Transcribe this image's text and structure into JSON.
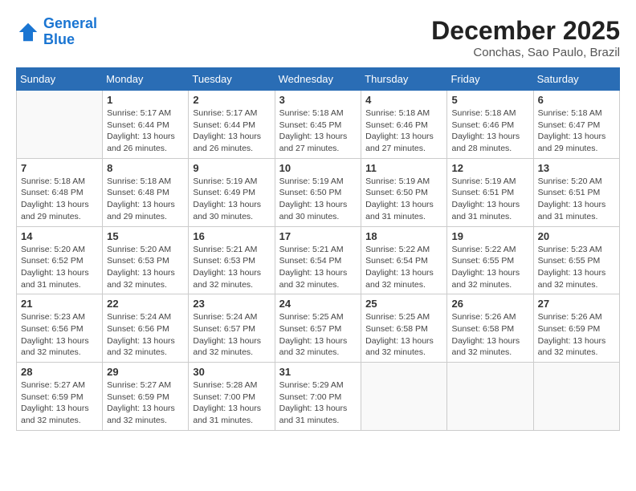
{
  "logo": {
    "line1": "General",
    "line2": "Blue"
  },
  "title": "December 2025",
  "location": "Conchas, Sao Paulo, Brazil",
  "days_of_week": [
    "Sunday",
    "Monday",
    "Tuesday",
    "Wednesday",
    "Thursday",
    "Friday",
    "Saturday"
  ],
  "weeks": [
    [
      {
        "day": "",
        "info": ""
      },
      {
        "day": "1",
        "info": "Sunrise: 5:17 AM\nSunset: 6:44 PM\nDaylight: 13 hours\nand 26 minutes."
      },
      {
        "day": "2",
        "info": "Sunrise: 5:17 AM\nSunset: 6:44 PM\nDaylight: 13 hours\nand 26 minutes."
      },
      {
        "day": "3",
        "info": "Sunrise: 5:18 AM\nSunset: 6:45 PM\nDaylight: 13 hours\nand 27 minutes."
      },
      {
        "day": "4",
        "info": "Sunrise: 5:18 AM\nSunset: 6:46 PM\nDaylight: 13 hours\nand 27 minutes."
      },
      {
        "day": "5",
        "info": "Sunrise: 5:18 AM\nSunset: 6:46 PM\nDaylight: 13 hours\nand 28 minutes."
      },
      {
        "day": "6",
        "info": "Sunrise: 5:18 AM\nSunset: 6:47 PM\nDaylight: 13 hours\nand 29 minutes."
      }
    ],
    [
      {
        "day": "7",
        "info": "Sunrise: 5:18 AM\nSunset: 6:48 PM\nDaylight: 13 hours\nand 29 minutes."
      },
      {
        "day": "8",
        "info": "Sunrise: 5:18 AM\nSunset: 6:48 PM\nDaylight: 13 hours\nand 29 minutes."
      },
      {
        "day": "9",
        "info": "Sunrise: 5:19 AM\nSunset: 6:49 PM\nDaylight: 13 hours\nand 30 minutes."
      },
      {
        "day": "10",
        "info": "Sunrise: 5:19 AM\nSunset: 6:50 PM\nDaylight: 13 hours\nand 30 minutes."
      },
      {
        "day": "11",
        "info": "Sunrise: 5:19 AM\nSunset: 6:50 PM\nDaylight: 13 hours\nand 31 minutes."
      },
      {
        "day": "12",
        "info": "Sunrise: 5:19 AM\nSunset: 6:51 PM\nDaylight: 13 hours\nand 31 minutes."
      },
      {
        "day": "13",
        "info": "Sunrise: 5:20 AM\nSunset: 6:51 PM\nDaylight: 13 hours\nand 31 minutes."
      }
    ],
    [
      {
        "day": "14",
        "info": "Sunrise: 5:20 AM\nSunset: 6:52 PM\nDaylight: 13 hours\nand 31 minutes."
      },
      {
        "day": "15",
        "info": "Sunrise: 5:20 AM\nSunset: 6:53 PM\nDaylight: 13 hours\nand 32 minutes."
      },
      {
        "day": "16",
        "info": "Sunrise: 5:21 AM\nSunset: 6:53 PM\nDaylight: 13 hours\nand 32 minutes."
      },
      {
        "day": "17",
        "info": "Sunrise: 5:21 AM\nSunset: 6:54 PM\nDaylight: 13 hours\nand 32 minutes."
      },
      {
        "day": "18",
        "info": "Sunrise: 5:22 AM\nSunset: 6:54 PM\nDaylight: 13 hours\nand 32 minutes."
      },
      {
        "day": "19",
        "info": "Sunrise: 5:22 AM\nSunset: 6:55 PM\nDaylight: 13 hours\nand 32 minutes."
      },
      {
        "day": "20",
        "info": "Sunrise: 5:23 AM\nSunset: 6:55 PM\nDaylight: 13 hours\nand 32 minutes."
      }
    ],
    [
      {
        "day": "21",
        "info": "Sunrise: 5:23 AM\nSunset: 6:56 PM\nDaylight: 13 hours\nand 32 minutes."
      },
      {
        "day": "22",
        "info": "Sunrise: 5:24 AM\nSunset: 6:56 PM\nDaylight: 13 hours\nand 32 minutes."
      },
      {
        "day": "23",
        "info": "Sunrise: 5:24 AM\nSunset: 6:57 PM\nDaylight: 13 hours\nand 32 minutes."
      },
      {
        "day": "24",
        "info": "Sunrise: 5:25 AM\nSunset: 6:57 PM\nDaylight: 13 hours\nand 32 minutes."
      },
      {
        "day": "25",
        "info": "Sunrise: 5:25 AM\nSunset: 6:58 PM\nDaylight: 13 hours\nand 32 minutes."
      },
      {
        "day": "26",
        "info": "Sunrise: 5:26 AM\nSunset: 6:58 PM\nDaylight: 13 hours\nand 32 minutes."
      },
      {
        "day": "27",
        "info": "Sunrise: 5:26 AM\nSunset: 6:59 PM\nDaylight: 13 hours\nand 32 minutes."
      }
    ],
    [
      {
        "day": "28",
        "info": "Sunrise: 5:27 AM\nSunset: 6:59 PM\nDaylight: 13 hours\nand 32 minutes."
      },
      {
        "day": "29",
        "info": "Sunrise: 5:27 AM\nSunset: 6:59 PM\nDaylight: 13 hours\nand 32 minutes."
      },
      {
        "day": "30",
        "info": "Sunrise: 5:28 AM\nSunset: 7:00 PM\nDaylight: 13 hours\nand 31 minutes."
      },
      {
        "day": "31",
        "info": "Sunrise: 5:29 AM\nSunset: 7:00 PM\nDaylight: 13 hours\nand 31 minutes."
      },
      {
        "day": "",
        "info": ""
      },
      {
        "day": "",
        "info": ""
      },
      {
        "day": "",
        "info": ""
      }
    ]
  ]
}
